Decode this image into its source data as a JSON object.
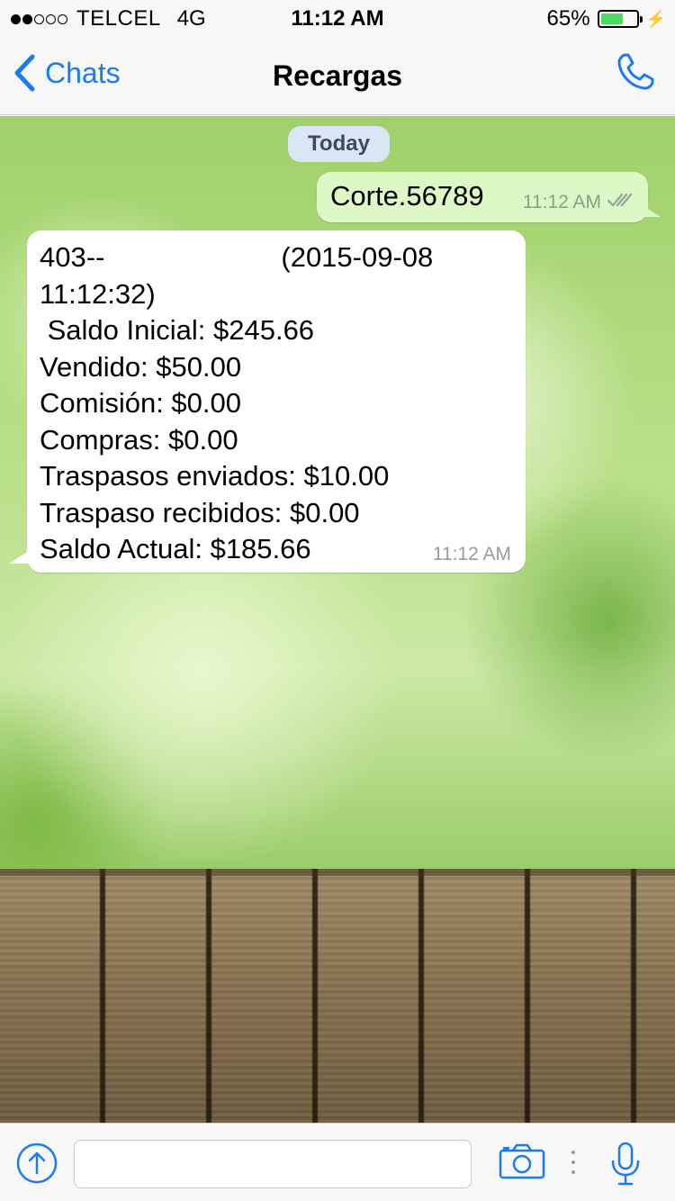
{
  "status_bar": {
    "carrier": "TELCEL",
    "network": "4G",
    "time": "11:12 AM",
    "battery_percent_label": "65%",
    "battery_level": 0.65,
    "signal_strength": 2
  },
  "nav": {
    "back_label": "Chats",
    "title": "Recargas"
  },
  "chat": {
    "date_chip": "Today",
    "outgoing": {
      "text": "Corte.56789",
      "time": "11:12 AM"
    },
    "incoming": {
      "line1_prefix": "403--",
      "line1_suffix": "(2015-09-08",
      "line2": "11:12:32)",
      "line3": " Saldo Inicial: $245.66",
      "line4": "Vendido: $50.00",
      "line5": "Comisión: $0.00",
      "line6": "Compras: $0.00",
      "line7": "Traspasos enviados: $10.00",
      "line8": "Traspaso recibidos: $0.00",
      "line9": "Saldo Actual: $185.66",
      "time": "11:12 AM"
    }
  },
  "input_bar": {
    "message_value": "",
    "message_placeholder": ""
  },
  "icons": {
    "back": "chevron-left-icon",
    "call": "phone-icon",
    "upload": "upload-icon",
    "camera": "camera-icon",
    "mic": "microphone-icon",
    "read": "double-check-icon"
  },
  "colors": {
    "accent": "#1b7bf0",
    "outgoing_bubble": "#dcf8c6",
    "incoming_bubble": "#ffffff",
    "battery": "#4cd964"
  }
}
